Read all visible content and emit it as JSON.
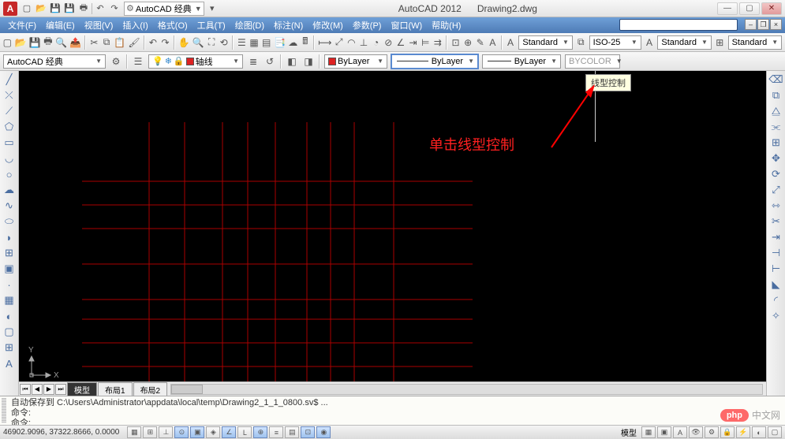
{
  "app": {
    "name": "AutoCAD 2012",
    "document": "Drawing2.dwg"
  },
  "workspace": {
    "label": "AutoCAD 经典"
  },
  "menu": {
    "file": "文件(F)",
    "edit": "编辑(E)",
    "view": "视图(V)",
    "insert": "插入(I)",
    "format": "格式(O)",
    "tools": "工具(T)",
    "draw": "绘图(D)",
    "dimension": "标注(N)",
    "modify": "修改(M)",
    "param": "参数(P)",
    "window": "窗口(W)",
    "help": "帮助(H)"
  },
  "toolbars": {
    "workspace2": "AutoCAD 经典",
    "layer_current": "轴线",
    "color_current": "ByLayer",
    "linetype_current": "ByLayer",
    "lineweight_current": "ByLayer",
    "plotstyle": "BYCOLOR",
    "dimstyle1": "Standard",
    "dimstyle2": "ISO-25",
    "dimstyle3": "Standard",
    "dimstyle4": "Standard"
  },
  "tooltip": "线型控制",
  "annotation": "单击线型控制",
  "tabs": {
    "model": "模型",
    "layout1": "布局1",
    "layout2": "布局2"
  },
  "cmd": {
    "line1": "自动保存到 C:\\Users\\Administrator\\appdata\\local\\temp\\Drawing2_1_1_0800.sv$ ...",
    "line2": "命令:",
    "prompt": "命令:"
  },
  "status": {
    "coords": "46902.9096, 37322.8666, 0.0000",
    "model_label": "模型"
  },
  "ucs": {
    "x": "X",
    "y": "Y"
  },
  "watermark": {
    "brand": "php",
    "site": "中文网"
  }
}
